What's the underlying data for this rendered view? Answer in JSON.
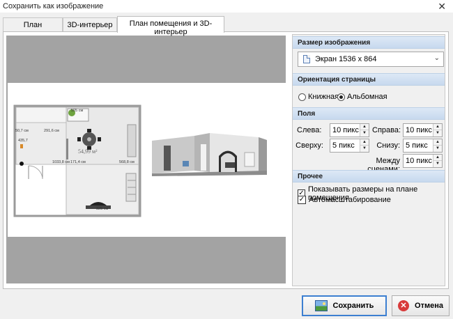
{
  "window": {
    "title": "Сохранить как изображение",
    "close_glyph": "✕"
  },
  "tabs": [
    {
      "label": "План помещения",
      "active": false
    },
    {
      "label": "3D-интерьер",
      "active": false
    },
    {
      "label": "План помещения и 3D-интерьер",
      "active": true
    }
  ],
  "preview": {
    "plan_labels": [
      "50,7 см",
      "291,6 см",
      "435,7",
      "1033,8 см",
      "171,4 см",
      "54,99 м²",
      "568,8 см",
      "325 см",
      "505 см"
    ]
  },
  "image_size": {
    "header": "Размер изображения",
    "selected": "Экран 1536 x 864"
  },
  "orientation": {
    "header": "Ориентация страницы",
    "options": [
      {
        "label": "Книжная",
        "checked": false
      },
      {
        "label": "Альбомная",
        "checked": true
      }
    ]
  },
  "margins": {
    "header": "Поля",
    "left_label": "Слева:",
    "left_value": "10 пикс",
    "right_label": "Справа:",
    "right_value": "10 пикс",
    "top_label": "Сверху:",
    "top_value": "5 пикс",
    "bottom_label": "Снизу:",
    "bottom_value": "5 пикс",
    "between_label": "Между сценами:",
    "between_value": "10 пикс"
  },
  "other": {
    "header": "Прочее",
    "options": [
      {
        "label": "Показывать размеры на плане помещения",
        "checked": true
      },
      {
        "label": "Автомасштабирование",
        "checked": true
      }
    ]
  },
  "buttons": {
    "save": "Сохранить",
    "cancel": "Отмена"
  },
  "glyphs": {
    "check": "✓",
    "combo_arrow": "⌄",
    "spin_up": "▲",
    "spin_down": "▼",
    "cancel_x": "✕"
  },
  "colors": {
    "accent": "#3c7fd1",
    "section": "#c7d9ee",
    "preview_bg": "#a3a3a3",
    "cancel_icon": "#d83b3b"
  }
}
